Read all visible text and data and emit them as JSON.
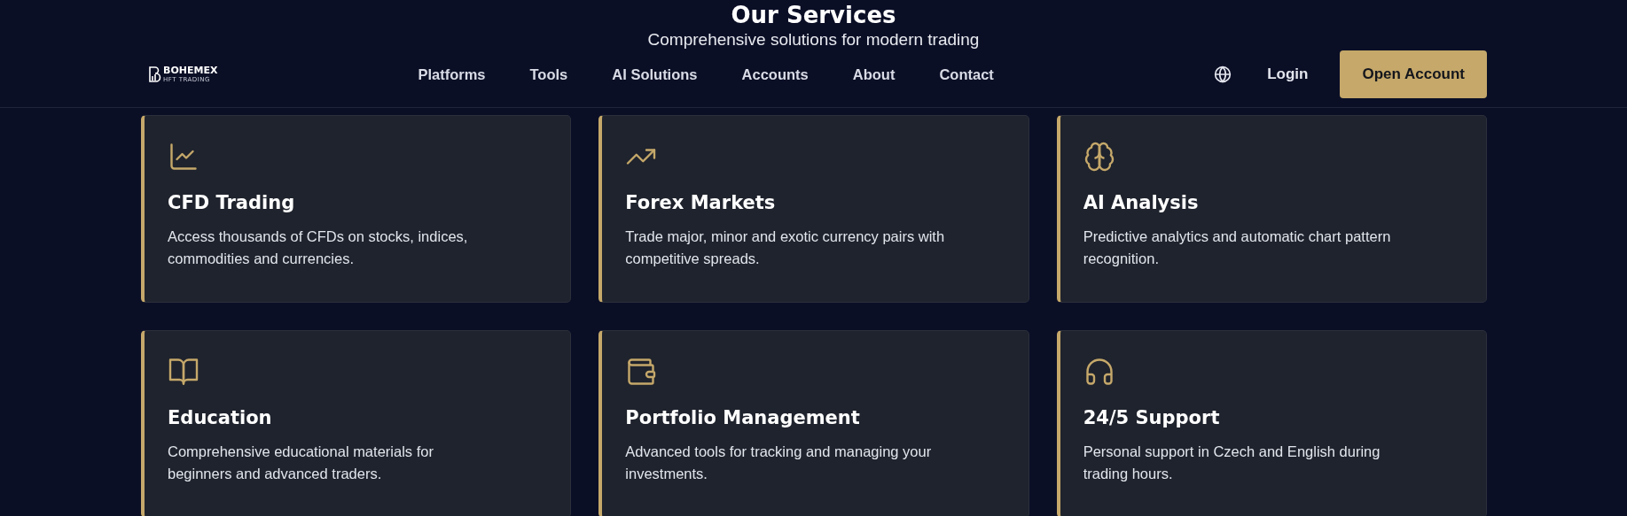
{
  "header": {
    "logo": {
      "name": "BOHEMEX",
      "tagline": "HFT TRADING"
    },
    "nav": [
      "Platforms",
      "Tools",
      "AI Solutions",
      "Accounts",
      "About",
      "Contact"
    ],
    "login": "Login",
    "cta": "Open Account"
  },
  "section": {
    "title": "Our Services",
    "subtitle": "Comprehensive solutions for modern trading"
  },
  "services": [
    {
      "title": "CFD Trading",
      "description": "Access thousands of CFDs on stocks, indices, commodities and currencies."
    },
    {
      "title": "Forex Markets",
      "description": "Trade major, minor and exotic currency pairs with competitive spreads."
    },
    {
      "title": "AI Analysis",
      "description": "Predictive analytics and automatic chart pattern recognition."
    },
    {
      "title": "Education",
      "description": "Comprehensive educational materials for beginners and advanced traders."
    },
    {
      "title": "Portfolio Management",
      "description": "Advanced tools for tracking and managing your investments."
    },
    {
      "title": "24/5 Support",
      "description": "Personal support in Czech and English during trading hours."
    }
  ]
}
